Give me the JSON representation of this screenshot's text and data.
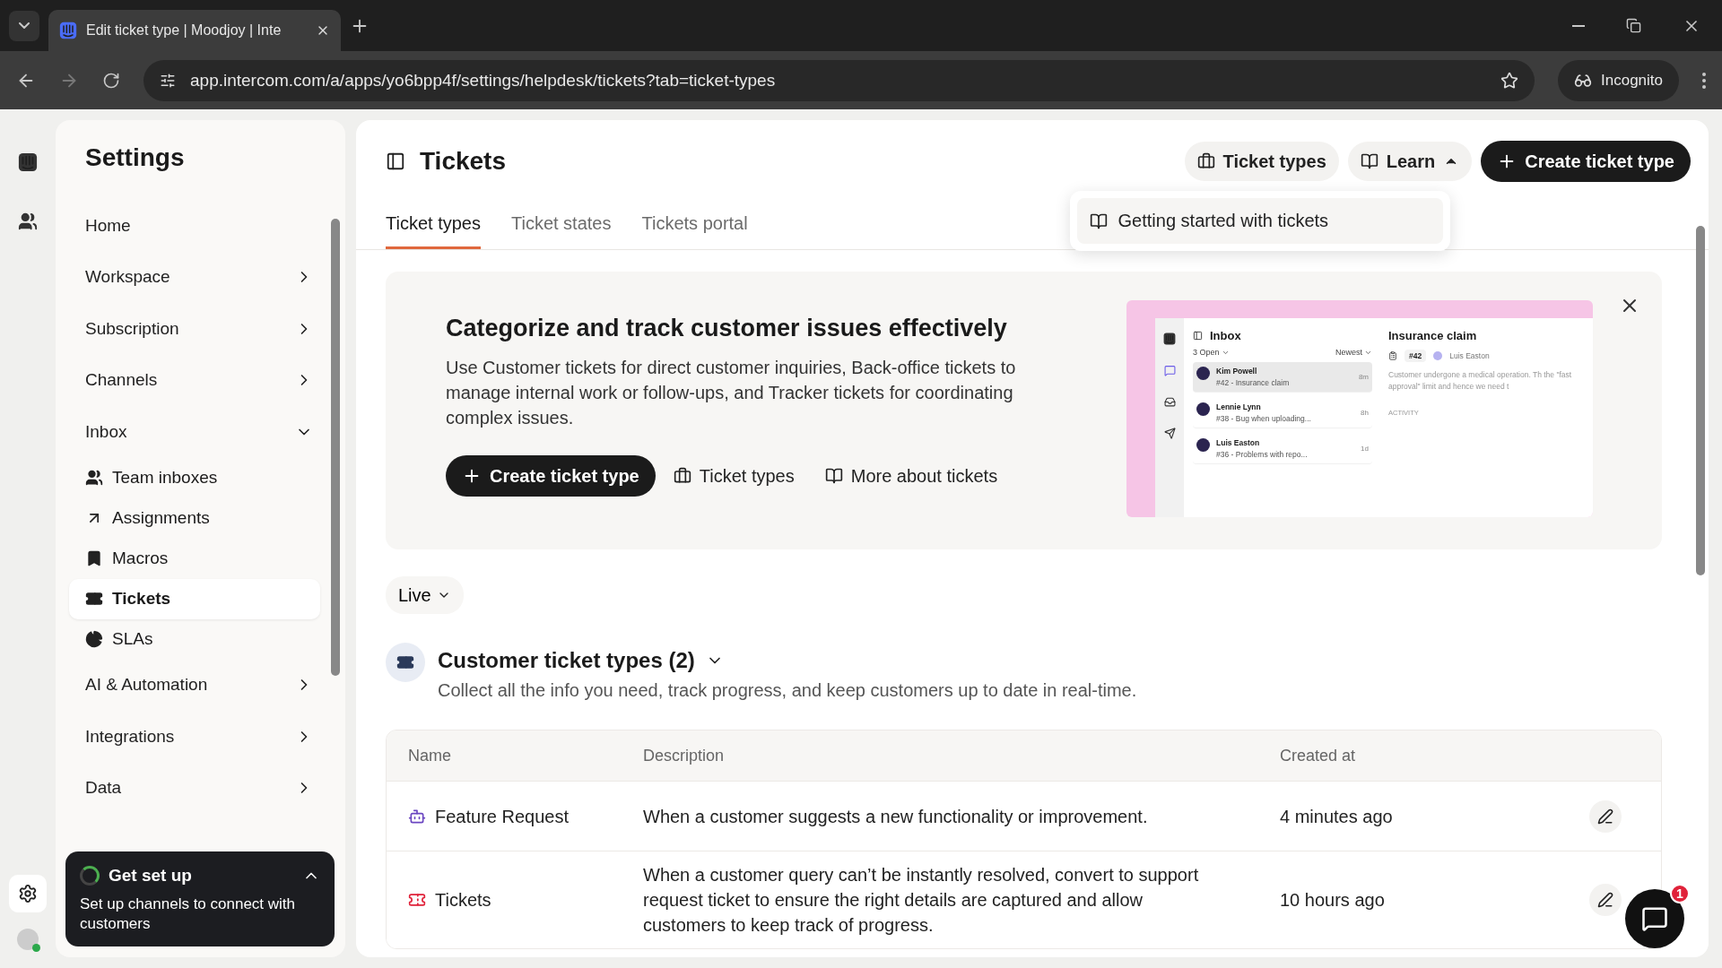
{
  "browser": {
    "tab_title": "Edit ticket type | Moodjoy | Inte",
    "url": "app.intercom.com/a/apps/yo6bpp4f/settings/helpdesk/tickets?tab=ticket-types",
    "profile": "Incognito"
  },
  "settings": {
    "title": "Settings",
    "items": [
      {
        "label": "Home",
        "kind": "link"
      },
      {
        "label": "Workspace",
        "kind": "group",
        "expanded": false
      },
      {
        "label": "Subscription",
        "kind": "group",
        "expanded": false
      },
      {
        "label": "Channels",
        "kind": "group",
        "expanded": false
      },
      {
        "label": "Inbox",
        "kind": "group",
        "expanded": true,
        "children": [
          {
            "label": "Team inboxes",
            "selected": false
          },
          {
            "label": "Assignments",
            "selected": false
          },
          {
            "label": "Macros",
            "selected": false
          },
          {
            "label": "Tickets",
            "selected": true
          },
          {
            "label": "SLAs",
            "selected": false
          }
        ]
      },
      {
        "label": "AI & Automation",
        "kind": "group",
        "expanded": false
      },
      {
        "label": "Integrations",
        "kind": "group",
        "expanded": false
      },
      {
        "label": "Data",
        "kind": "group",
        "expanded": false
      }
    ]
  },
  "setup_card": {
    "title": "Get set up",
    "text": "Set up channels to connect with customers",
    "expanded": true
  },
  "page": {
    "title": "Tickets",
    "actions": [
      {
        "label": "Ticket types",
        "kind": "plain"
      },
      {
        "label": "Learn",
        "kind": "menu",
        "expanded": true
      },
      {
        "label": "Create ticket type",
        "kind": "primary"
      }
    ],
    "learn_menu": [
      "Getting started with tickets"
    ],
    "tabs": [
      {
        "label": "Ticket types",
        "selected": true
      },
      {
        "label": "Ticket states",
        "selected": false
      },
      {
        "label": "Tickets portal",
        "selected": false
      }
    ]
  },
  "banner": {
    "title": "Categorize and track customer issues effectively",
    "text": "Use Customer tickets for direct customer inquiries, Back-office tickets to manage internal work or follow-ups, and Tracker tickets for coordinating complex issues.",
    "actions": [
      {
        "label": "Create ticket type",
        "kind": "primary"
      },
      {
        "label": "Ticket types",
        "kind": "plain"
      },
      {
        "label": "More about tickets",
        "kind": "plain"
      }
    ],
    "preview": {
      "list_title": "Inbox",
      "filter": "3 Open",
      "sort": "Newest",
      "conversations": [
        {
          "name": "Kim Powell",
          "subject": "#42 - Insurance claim",
          "time": "8m",
          "selected": true
        },
        {
          "name": "Lennie Lynn",
          "subject": "#38 - Bug when uploading...",
          "time": "8h",
          "selected": false
        },
        {
          "name": "Luis Easton",
          "subject": "#36 - Problems with repo...",
          "time": "1d",
          "selected": false
        }
      ],
      "detail_title": "Insurance claim",
      "ticket_id": "#42",
      "assignee": "Luis Easton",
      "detail_text": "Customer undergone a medical operation. Th the \"fast approval\" limit and hence we need t",
      "activity_label": "ACTIVITY"
    }
  },
  "filter": {
    "label": "Live"
  },
  "section": {
    "title": "Customer ticket types (2)",
    "description": "Collect all the info you need, track progress, and keep customers up to date in real-time.",
    "expanded": true
  },
  "table": {
    "columns": [
      "Name",
      "Description",
      "Created at"
    ],
    "rows": [
      {
        "name": "Feature Request",
        "description": "When a customer suggests a new functionality or improvement.",
        "created_at": "4 minutes ago"
      },
      {
        "name": "Tickets",
        "description": "When a customer query can’t be instantly resolved, convert to support request ticket to ensure the right details are captured and allow customers to keep track of progress.",
        "created_at": "10 hours ago"
      }
    ]
  },
  "messenger": {
    "badge": "1"
  }
}
